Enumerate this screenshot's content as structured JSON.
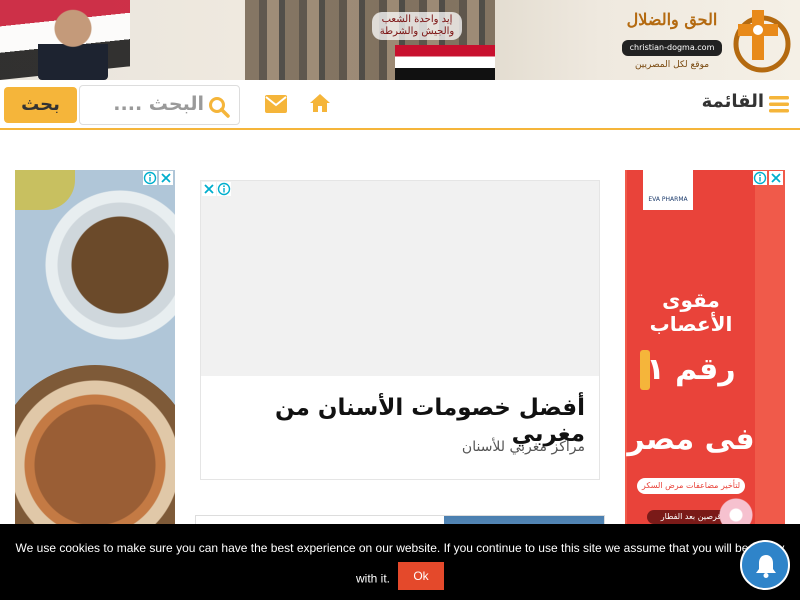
{
  "site": {
    "logo_title": "الحق والضلال",
    "logo_url": "christian-dogma.com",
    "logo_tagline": "موقع لكل المصريين",
    "banner_slogan": "إيد واحدة الشعب والجيش والشرطة"
  },
  "navbar": {
    "search_button": "بحث",
    "search_placeholder": "البحث ....",
    "menu_label": "القائمة",
    "icons": [
      "search-icon",
      "mail-icon",
      "home-icon",
      "menu-icon"
    ],
    "accent_color": "#f5b53a"
  },
  "ads": {
    "center": {
      "headline": "أفضل خصومات الأسنان من مغربي",
      "sponsor": "مراكز مغربي للأسنان"
    },
    "right": {
      "brand": "EVA PHARMA",
      "line1": "مقوى الأعصاب",
      "line2": "رقم ١",
      "line3": "فى مصر",
      "line4": "لتأخير مضاعفات مرض السكر",
      "line5": "قرصين بعد الفطار",
      "bg_color": "#e9433a"
    }
  },
  "cookie_bar": {
    "message_line1": "We use cookies to make sure you can have the best experience on our website. If you continue to use this site we assume that you will be happy",
    "message_line2": "with it.",
    "ok_button": "Ok",
    "button_color": "#e4492b"
  },
  "notification": {
    "icon": "bell-icon",
    "color": "#2f84c9"
  }
}
